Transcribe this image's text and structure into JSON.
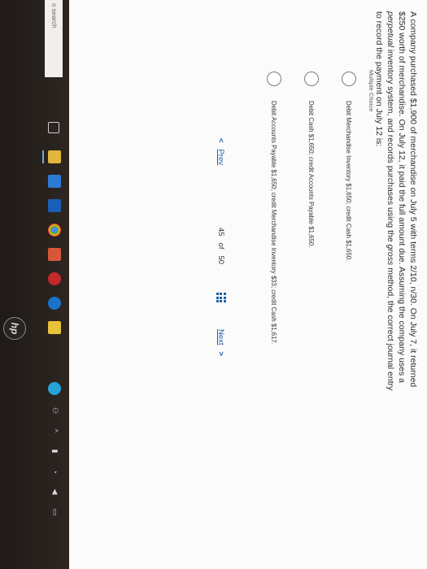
{
  "question": {
    "text_part1": "A company purchased $1,900 of merchandise on July 5 with terms 2/10, n/30. On July 7, it returned $250 worth of merchandise. On July 12, it paid the full amount due. Assuming the company uses a ",
    "text_italic1": "perpetual",
    "text_part2": " inventory system, and records purchases using the ",
    "text_italic2": "gross",
    "text_part3": " method, the correct journal entry to record the payment on July 12 is:"
  },
  "multiple_choice_title": "Multiple Choice",
  "choices": [
    {
      "label": "Debit Merchandise Inventory $1,650; credit Cash $1,650."
    },
    {
      "label": "Debit Cash $1,650; credit Accounts Payable $1,650."
    },
    {
      "label": "Debit Accounts Payable $1,650; credit Merchandise Inventory $33; credit Cash $1,617."
    }
  ],
  "navigation": {
    "prev_label": "Prev",
    "current": "45",
    "of_label": "of",
    "total": "50",
    "next_label": "Next",
    "prev_arrow": "<",
    "next_arrow": ">"
  },
  "taskbar": {
    "search_placeholder": "o search",
    "icons": [
      "task-view-icon",
      "file-explorer-icon",
      "store-icon",
      "mail-icon",
      "chrome-icon",
      "media-icon",
      "security-icon",
      "edge-icon",
      "onedrive-icon",
      "skype-icon"
    ]
  },
  "laptop": {
    "brand": "hp"
  },
  "colors": {
    "link": "#1d5fa8",
    "taskbar": "#1f1a17",
    "page": "#fbfbfb"
  }
}
